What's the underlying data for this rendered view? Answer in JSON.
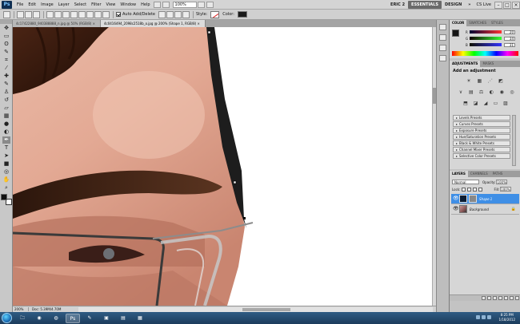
{
  "app": {
    "logo": "Ps",
    "menu": [
      "File",
      "Edit",
      "Image",
      "Layer",
      "Select",
      "Filter",
      "View",
      "Window",
      "Help"
    ],
    "zoom_display": "100%",
    "workspace": {
      "user": "ERIC 2",
      "essentials": "ESSENTIALS",
      "design": "DESIGN",
      "more": "»",
      "cs_live": "CS Live"
    },
    "window_controls": {
      "minimize": "–",
      "maximize": "□",
      "close": "×"
    }
  },
  "options_bar": {
    "auto_add_delete": "Auto Add/Delete",
    "style_label": "Style:",
    "color_label": "Color:",
    "shape_color": "#1a1a1a"
  },
  "tools": {
    "items": [
      {
        "name": "move",
        "glyph": "✥"
      },
      {
        "name": "marquee",
        "glyph": "▭"
      },
      {
        "name": "lasso",
        "glyph": "ʘ"
      },
      {
        "name": "quick-select",
        "glyph": "✎"
      },
      {
        "name": "crop",
        "glyph": "⌗"
      },
      {
        "name": "eyedropper",
        "glyph": "⁄"
      },
      {
        "name": "healing-brush",
        "glyph": "✚"
      },
      {
        "name": "brush",
        "glyph": "✎"
      },
      {
        "name": "clone-stamp",
        "glyph": "♙"
      },
      {
        "name": "history-brush",
        "glyph": "↺"
      },
      {
        "name": "eraser",
        "glyph": "▱"
      },
      {
        "name": "gradient",
        "glyph": "▦"
      },
      {
        "name": "blur",
        "glyph": "●"
      },
      {
        "name": "dodge",
        "glyph": "◐"
      },
      {
        "name": "pen",
        "glyph": "✒"
      },
      {
        "name": "type",
        "glyph": "T"
      },
      {
        "name": "path-select",
        "glyph": "➤"
      },
      {
        "name": "shape",
        "glyph": "■"
      },
      {
        "name": "3d-rotate",
        "glyph": "◎"
      },
      {
        "name": "hand",
        "glyph": "✋"
      },
      {
        "name": "zoom",
        "glyph": "⌕"
      }
    ],
    "active_index": 14
  },
  "documents": {
    "tabs": [
      {
        "label": "4c17422880_940388888_n.jpg @ 50% (RGB/8) ×"
      },
      {
        "label": "4c0416494_2098c2518b_o.jpg @ 200% (Shape 1, RGB/8) ×"
      }
    ],
    "active_index": 1
  },
  "status": {
    "zoom": "200%",
    "doc_size": "Doc: 5.39M/4.70M"
  },
  "color_panel": {
    "tabs": [
      "COLOR",
      "SWATCHES",
      "STYLES"
    ],
    "active_tab": 0,
    "foreground": "#161616",
    "rows": [
      {
        "label": "R",
        "value": "20"
      },
      {
        "label": "G",
        "value": "34"
      },
      {
        "label": "B",
        "value": "31"
      }
    ]
  },
  "adjustments_panel": {
    "tabs": [
      "ADJUSTMENTS",
      "MASKS"
    ],
    "active_tab": 0,
    "title": "Add an adjustment",
    "row1": [
      "☀",
      "▦",
      "⋰",
      "◩"
    ],
    "row2": [
      "∨",
      "▤",
      "⚖",
      "◐",
      "◉",
      "◎"
    ],
    "row3": [
      "⬒",
      "◪",
      "◢",
      "▭",
      "▨"
    ],
    "presets": [
      "Levels Presets",
      "Curves Presets",
      "Exposure Presets",
      "Hue/Saturation Presets",
      "Black & White Presets",
      "Channel Mixer Presets",
      "Selective Color Presets"
    ]
  },
  "layers_panel": {
    "tabs": [
      "LAYERS",
      "CHANNELS",
      "PATHS"
    ],
    "active_tab": 0,
    "blend_mode": "Normal",
    "opacity_label": "Opacity:",
    "opacity": "100%",
    "lock_label": "Lock:",
    "fill_label": "Fill:",
    "fill": "100%",
    "layers": [
      {
        "name": "Shape 1",
        "selected": true
      },
      {
        "name": "Background",
        "selected": false
      }
    ]
  },
  "taskbar": {
    "apps": [
      {
        "name": "explorer",
        "glyph": "🗀"
      },
      {
        "name": "chrome",
        "glyph": "◉"
      },
      {
        "name": "firefox",
        "glyph": "◍"
      },
      {
        "name": "photoshop",
        "glyph": "Ps"
      },
      {
        "name": "paint",
        "glyph": "✎"
      },
      {
        "name": "media",
        "glyph": "▣"
      },
      {
        "name": "folder",
        "glyph": "▤"
      },
      {
        "name": "app-green",
        "glyph": "▦"
      }
    ],
    "active_app": 3,
    "time": "8:25 PM",
    "date": "1/18/2012"
  }
}
